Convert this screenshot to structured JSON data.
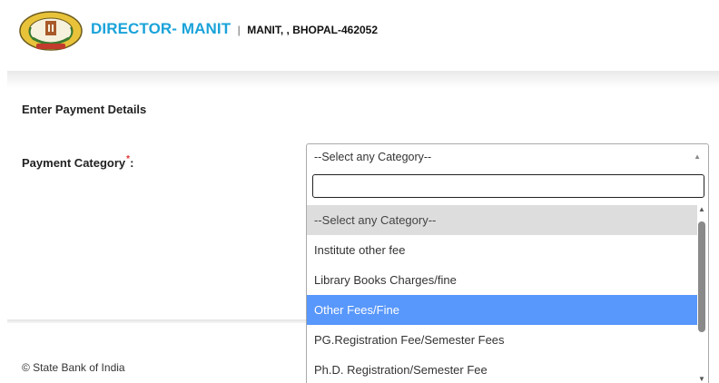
{
  "header": {
    "brand_name": "DIRECTOR- MANIT",
    "separator": "|",
    "address": "MANIT, , BHOPAL-462052",
    "logo": "manit-emblem"
  },
  "form": {
    "section_title": "Enter Payment Details",
    "category_label": "Payment Category",
    "required_mark": "*",
    "label_suffix": ":",
    "selected_value": "--Select any Category--",
    "search_value": "",
    "options": [
      "--Select any Category--",
      "Institute other fee",
      "Library Books Charges/fine",
      "Other Fees/Fine",
      "PG.Registration Fee/Semester Fees",
      "Ph.D. Registration/Semester Fee"
    ],
    "highlighted_option": "Other Fees/Fine"
  },
  "footer": {
    "copyright": "© State Bank of India"
  },
  "colors": {
    "brand": "#1aa3d9",
    "highlight": "#5897fb",
    "required": "#e03030"
  }
}
